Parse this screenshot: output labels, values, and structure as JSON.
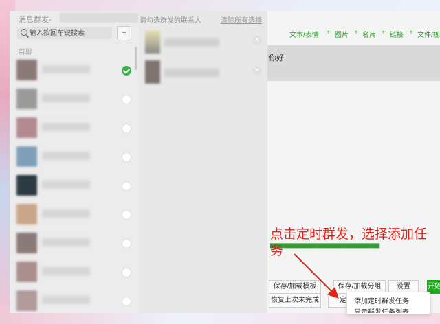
{
  "window": {
    "title": "消息群发-"
  },
  "search": {
    "placeholder": "输入按回车键搜索"
  },
  "left": {
    "add_label": "+",
    "section_label": "群聊",
    "contacts": [
      {
        "checked": true,
        "avatar_color": "#8a7b78"
      },
      {
        "checked": false,
        "avatar_color": "#9a9a98"
      },
      {
        "checked": false,
        "avatar_color": "#b48a92"
      },
      {
        "checked": false,
        "avatar_color": "#7fa0b8"
      },
      {
        "checked": false,
        "avatar_color": "#2c3a44"
      },
      {
        "checked": false,
        "avatar_color": "#c9a68a"
      },
      {
        "checked": false,
        "avatar_color": "#8c7a7a"
      },
      {
        "checked": false,
        "avatar_color": "#a98e8c"
      },
      {
        "checked": false,
        "avatar_color": "#b09a9a"
      }
    ]
  },
  "middle": {
    "header": "请勾选群发的联系人",
    "clear_link": "清除所有选择"
  },
  "toolbar": {
    "text": "文本/表情",
    "image": "图片",
    "card": "名片",
    "link": "链接",
    "file": "文件/视"
  },
  "message": {
    "text": "你好"
  },
  "annotation": {
    "text": "点击定时群发，选择添加任务"
  },
  "buttons": {
    "save_template": "保存/加载模板",
    "save_group": "保存/加载分组",
    "settings": "设置",
    "start": "开始",
    "restore": "恢复上次未完成",
    "scheduled": "定时群发"
  },
  "dropdown": {
    "item1": "添加定时群发任务",
    "item2": "显示群发任务列表"
  },
  "colors": {
    "accent_green": "#1aad19",
    "annotation_red": "#e0241a"
  }
}
